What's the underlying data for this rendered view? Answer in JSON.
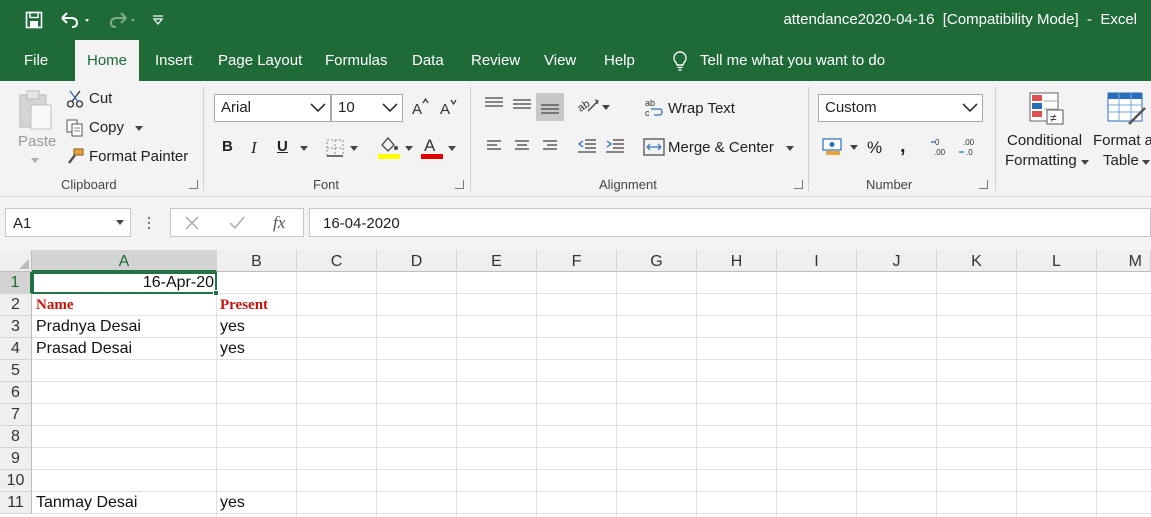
{
  "titlebar": {
    "title": "attendance2020-04-16  [Compatibility Mode]  -  Excel",
    "icons": [
      "save-icon",
      "undo-icon",
      "redo-icon",
      "customize-qat-icon"
    ]
  },
  "tabs": [
    "File",
    "Home",
    "Insert",
    "Page Layout",
    "Formulas",
    "Data",
    "Review",
    "View",
    "Help"
  ],
  "active_tab": "Home",
  "tell_me": "Tell me what you want to do",
  "ribbon": {
    "clipboard": {
      "label": "Clipboard",
      "paste": "Paste",
      "cut": "Cut",
      "copy": "Copy",
      "format_painter": "Format Painter"
    },
    "font": {
      "label": "Font",
      "font_name": "Arial",
      "font_size": "10",
      "font_color": "#e00000",
      "highlight_color": "#ffff00"
    },
    "alignment": {
      "label": "Alignment",
      "wrap_text": "Wrap Text",
      "merge_center": "Merge & Center"
    },
    "number": {
      "label": "Number",
      "format": "Custom"
    },
    "styles": {
      "conditional_1": "Conditional",
      "conditional_2": "Formatting",
      "format_as_1": "Format as",
      "format_as_2": "Table"
    }
  },
  "formula_bar": {
    "name_box": "A1",
    "fx": "fx",
    "formula": "16-04-2020"
  },
  "sheet": {
    "columns": [
      "A",
      "B",
      "C",
      "D",
      "E",
      "F",
      "G",
      "H",
      "I",
      "J",
      "K",
      "L",
      "M"
    ],
    "rows": [
      "1",
      "2",
      "3",
      "4",
      "5",
      "6",
      "7",
      "8",
      "9",
      "10",
      "11"
    ],
    "selected_cell": "A1",
    "cells": {
      "A1": "16-Apr-20",
      "A2": "Name",
      "B2": "Present",
      "A3": "Pradnya Desai",
      "B3": "yes",
      "A4": "Prasad Desai",
      "B4": "yes",
      "A11": "Tanmay Desai",
      "B11": "yes"
    }
  },
  "colors": {
    "brand_green": "#1e6b38",
    "header_red": "#c0140e",
    "selection_green": "#217346"
  }
}
